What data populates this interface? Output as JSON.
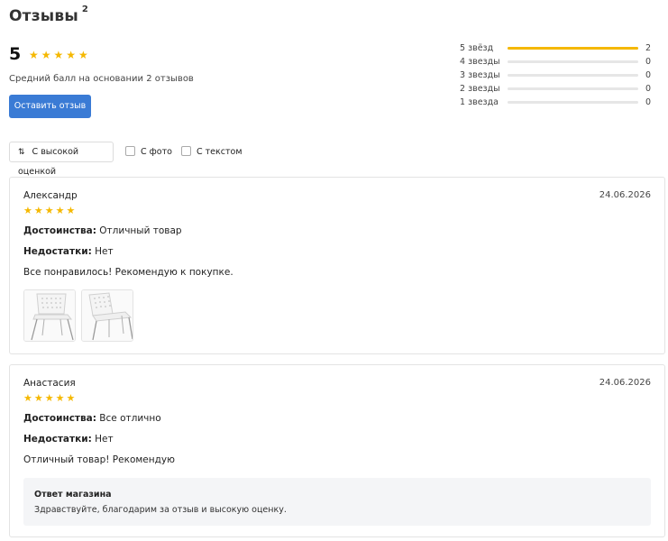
{
  "header": {
    "title": "Отзывы",
    "count": "2"
  },
  "summary": {
    "score": "5",
    "stars": "★★★★★",
    "avg_text": "Средний балл на основании 2 отзывов",
    "leave_review_label": "Оставить отзыв"
  },
  "distribution": [
    {
      "label": "5 звёзд",
      "count": "2",
      "fraction": 1.0
    },
    {
      "label": "4 звезды",
      "count": "0",
      "fraction": 0
    },
    {
      "label": "3 звезды",
      "count": "0",
      "fraction": 0
    },
    {
      "label": "2 звезды",
      "count": "0",
      "fraction": 0
    },
    {
      "label": "1 звезда",
      "count": "0",
      "fraction": 0
    }
  ],
  "filters": {
    "sort_label": "С высокой оценкой",
    "sort_icon": "⇅",
    "with_photo_label": "С фото",
    "with_text_label": "С текстом"
  },
  "reviews": [
    {
      "author": "Александр",
      "date": "24.06.2026",
      "stars": "★★★★★",
      "pros_label": "Достоинства:",
      "pros": "Отличный товар",
      "cons_label": "Недостатки:",
      "cons": "Нет",
      "text": "Все понравилось! Рекомендую к покупке."
    },
    {
      "author": "Анастасия",
      "date": "24.06.2026",
      "stars": "★★★★★",
      "pros_label": "Достоинства:",
      "pros": "Все отлично",
      "cons_label": "Недостатки:",
      "cons": "Нет",
      "text": "Отличный товар! Рекомендую",
      "reply_title": "Ответ магазина",
      "reply_text": "Здравствуйте, благодарим за отзыв и высокую оценку."
    }
  ],
  "colors": {
    "accent": "#3a7bd5",
    "star": "#f5b800"
  }
}
